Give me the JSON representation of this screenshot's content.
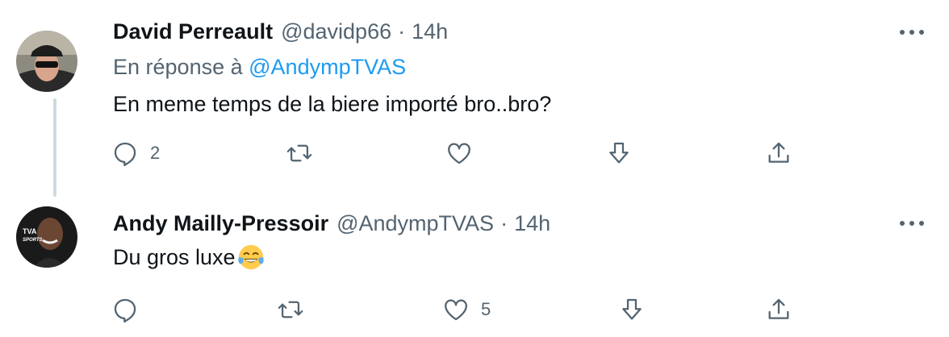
{
  "tweets": [
    {
      "name": "David Perreault",
      "handle": "@davidp66",
      "separator": "·",
      "time": "14h",
      "reply_prefix": "En réponse à",
      "reply_handle": "@AndympTVAS",
      "text": "En meme temps de la biere importé bro..bro?",
      "counts": {
        "reply": "2",
        "retweet": "",
        "like": "",
        "share": ""
      }
    },
    {
      "name": "Andy Mailly-Pressoir",
      "handle": "@AndympTVAS",
      "separator": "·",
      "time": "14h",
      "text": "Du gros luxe",
      "emoji": "face-with-tears-of-joy",
      "avatar_badge_top": "TVA",
      "avatar_badge_bottom": "SPORTS",
      "counts": {
        "reply": "",
        "retweet": "",
        "like": "5",
        "share": ""
      }
    }
  ],
  "colors": {
    "text": "#0f1419",
    "secondary": "#536471",
    "link": "#1d9bf0",
    "thread_line": "#cfd9de"
  }
}
